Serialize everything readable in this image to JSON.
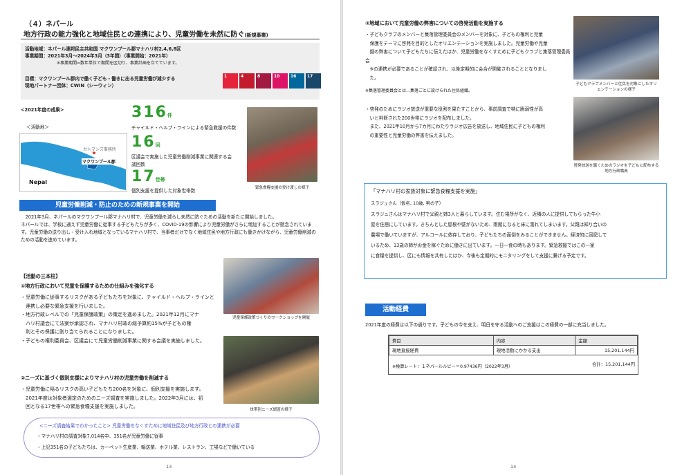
{
  "left_page": {
    "section_heading": "（４）ネパール",
    "title": "地方行政の能力強化と地域住民との連携により、児童労働を未然に防ぐ",
    "title_tag": "(新規事業)",
    "info": {
      "area": "活動地域：ネパール連邦民主共和国 マクワンプール郡マナハリ村2,4,6,8区",
      "period": "事業期間：2021年3月〜2024年3月（3年間）（事業開始：2021年）",
      "note": "※事業期間=数年単位で期間を区切り、事業計画を立てています。",
      "goal": "目標：マクワンプール郡内で働く子ども・働きに出る児童労働が減少する",
      "partner": "現地パートナー団体：CWIN（シーウィン）"
    },
    "sdg_numbers": [
      "1",
      "4",
      "8",
      "10",
      "16",
      "17"
    ],
    "sdg_colors": [
      "#e5243b",
      "#c5192d",
      "#a21942",
      "#dd1367",
      "#00689d",
      "#19486a"
    ],
    "results_title": "<2021年度の成果>",
    "map": {
      "label": "＜活動地＞",
      "kathmandu": "カトマンズ事務所",
      "makwanpur": "マクワンプール郡",
      "nepal": "Nepal"
    },
    "stats": [
      {
        "number": "316",
        "unit": "件",
        "desc": "チャイルド・ヘルプ・ラインによる緊急救援の件数"
      },
      {
        "number": "16",
        "unit": "回",
        "desc": "区議会で実施した児童労働削減事業に関連する会議回数"
      },
      {
        "number": "17",
        "unit": "世帯",
        "desc": "個別支援を提供した対象世帯数"
      }
    ],
    "photo1_caption": "緊急食糧支援の受け渡しの様子",
    "new_project_bar": "児童労働削減・防止のための新規事業を開始",
    "intro_paragraph": [
      "2021年3月、ネパールのマクワンプール郡マナハリ村で、児童労働を減らし未然に防ぐための活動を新たに開始しました。",
      "ネパールでは、学校に通えず児童労働に従事する子どもたちが多く、COVID-19の影響により児童労働がさらに増加することが懸念されています。児童労働の送り出し・受け入れ地域となっているマナハリ村で、当事者だけでなく地域住民や地方行政にも働きかけながら、児童労働削減のための活動を進めています。"
    ],
    "pillars_title": "【活動の三本柱】",
    "pillar1_title": "①地方行政において児童を保護するための仕組みを強化する",
    "pillar1_bullets": [
      "・児童労働に従事するリスクがある子どもたちを対象に、チャイルド・ヘルプ・ラインと",
      "　連携し必要な緊急支援を行いました。",
      "・地方行政レベルでの「児童保護政策」の策定を進めました。2021年12月にマナ",
      "　ハリ村議会にて法案が承認され、マナハリ村政の総予算約15%が子どもの権",
      "　利とその保護に割り当てられることになりました。",
      "・子どもの権利委員会、区議会にて児童労働削減事業に関する会議を実施しました。"
    ],
    "photo2_caption": "児童保護政策づくりのワークショップを開催",
    "pillar2_title": "②ニーズに基づく個別支援によりマナハリ村の児童労働を削減する",
    "pillar2_bullets": [
      "・児童労働に陥るリスクの高い子どもたち200名を対象に、個別支援を実施します。",
      "　2021年度は対象者選定のためのニーズ調査を実施しました。2022年3月には、初",
      "　回となる17世帯への緊急食糧支援を実施しました。"
    ],
    "photo3_caption": "世帯別ニーズ調査の様子",
    "survey_box": {
      "title": "<ニーズ調査結果でわかったこと> 児童労働をなくすために地域住民及び地方行政との連携が必要",
      "items": [
        "・マナハリ村の調査対象7,014名中、351名が児童労働に従事",
        "・上記351名の子どもたちは、カーペット生産業、輸送業、ホテル業、レストラン、工場などで働いている"
      ]
    },
    "page_number": "13"
  },
  "right_page": {
    "pillar3_title": "③地域において児童労働の弊害についての啓発活動を実施する",
    "pillar3_paragraph": [
      "・子どもクラブのメンバーと集落管理委員会のメンバーを対象に、子どもの権利と児童",
      "　保護をテーマに啓発を目的としたオリエンテーションを実施しました。児童労働や児童",
      "　婚の弊害について子どもたちに伝えたほか、児童労働をなくすために子どもクラブと集落管理委員会",
      "　※の連携が必要であることが確認され、以後定期的に会合が開催されることとなりまし",
      "　た。"
    ],
    "pillar3_note": "※集落管理委員会とは…集落ごとに設けられた住民組織。",
    "photo4_caption": "子どもクラブメンバーと住民を対象にしたオリエンテーションの様子",
    "radio_paragraph": [
      "・啓発のためにラジオ放送が重要な役割を果たすことから、事前調査で特に脆弱性が高",
      "　いと判断された200世帯にラジオを配布しました。",
      "　また、2021年10月から7カ月にわたりラジオ広告を放送し、地域住民に子どもの権利",
      "　の重要性と児童労働の弊害を伝えました。"
    ],
    "photo5_caption": "啓発放送を聴くためのラジオを子どもに配布する地方行政職員",
    "story_box": {
      "title": "「マナハリ村の家族対象に緊急食糧支援を実施」",
      "subtitle": "スラジュさん（仮名, 10歳, 男の子）",
      "body": [
        "スラジュさんはマナハリ村で父親と姉3人と暮らしています。住む場所がなく、近隣の人に提供してもらった牛小",
        "屋を住居にしています。きちんとした屋根や壁がないため、雨期になると床に濡れてしまいます。父親は知り合いの",
        "農場で働いていますが、アルコールに依存しており、子どもたちの面倒をみることができません。経済的に困窮して",
        "いるため、13歳の姉がお金を稼ぐために働きに出ています。一日一食の時もあります。緊急救援ではこの一家",
        "に食糧を提供し、区にも情報を共有したほか、今後も定期的にモニタリングをして支援に繋げる予定です。"
      ]
    },
    "expense_bar": "活動経費",
    "expense_intro": "2021年度の経費は以下の通りです。子どもの今を支え、明日を守る活動へのご支援はこの経費の一部に充当しました。",
    "expense_table": {
      "headers": [
        "費目",
        "内容",
        "金額"
      ],
      "row": [
        "現地直接経費",
        "現地活動にかかる支出",
        "15,201,144円"
      ],
      "rate_note": "※換算レート：１ネパールルピー＝0.97436円（2022年3月）",
      "total": "合計：15,201,144円"
    },
    "page_number": "14"
  }
}
